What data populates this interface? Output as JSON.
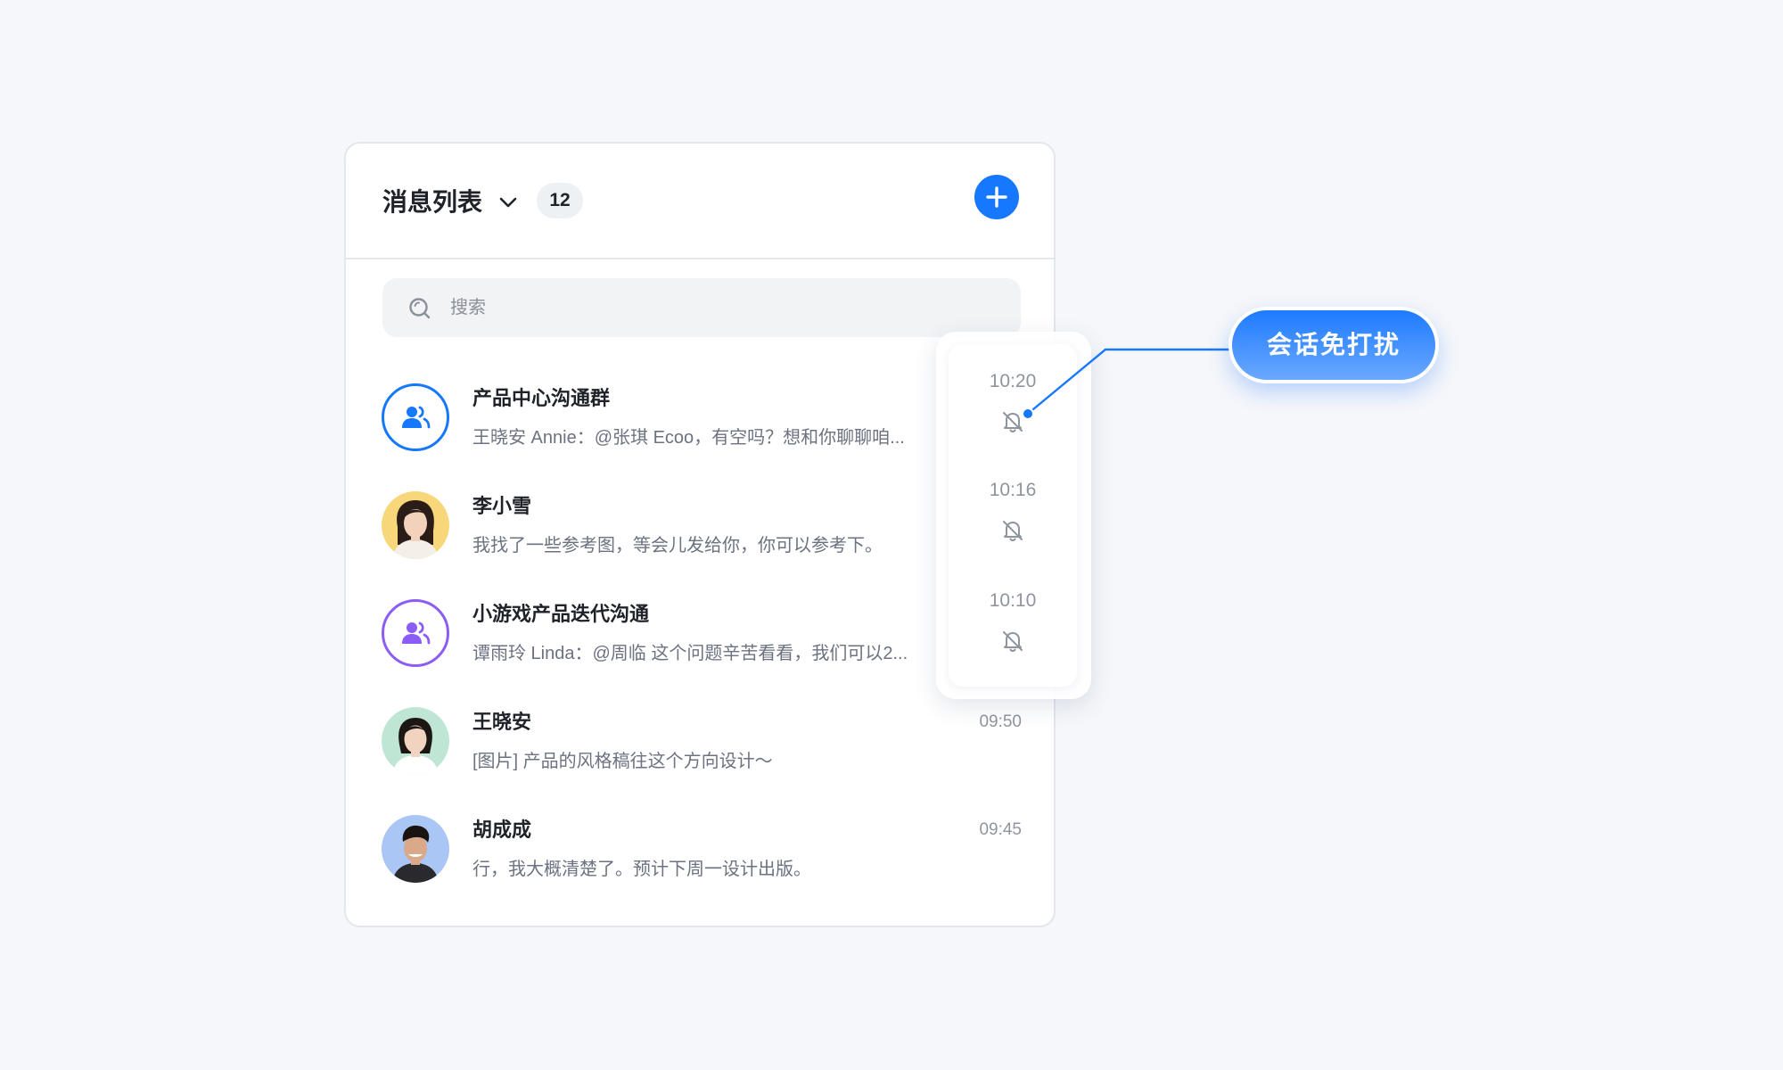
{
  "header": {
    "title": "消息列表",
    "count": "12"
  },
  "search": {
    "placeholder": "搜索"
  },
  "conversations": [
    {
      "name": "产品中心沟通群",
      "preview": "王晓安 Annie：@张琪 Ecoo，有空吗？想和你聊聊咱...",
      "time": "",
      "avatar": "group-blue",
      "muted": true
    },
    {
      "name": "李小雪",
      "preview": "我找了一些参考图，等会儿发给你，你可以参考下。",
      "time": "",
      "avatar": "photo-woman-yellow",
      "muted": true
    },
    {
      "name": "小游戏产品迭代沟通",
      "preview": "谭雨玲 Linda：@周临 这个问题辛苦看看，我们可以2...",
      "time": "",
      "avatar": "group-purple",
      "muted": true
    },
    {
      "name": "王晓安",
      "preview": "[图片] 产品的风格稿往这个方向设计～",
      "time": "09:50",
      "avatar": "photo-woman-green",
      "muted": false
    },
    {
      "name": "胡成成",
      "preview": "行，我大概清楚了。预计下周一设计出版。",
      "time": "09:45",
      "avatar": "photo-man-blue",
      "muted": false
    }
  ],
  "popup": {
    "rows": [
      {
        "time": "10:20",
        "icon": "bell-off-icon"
      },
      {
        "time": "10:16",
        "icon": "bell-off-icon"
      },
      {
        "time": "10:10",
        "icon": "bell-off-icon"
      }
    ]
  },
  "callout": {
    "label": "会话免打扰"
  },
  "colors": {
    "accent": "#1677ff",
    "purple": "#8b5cf6",
    "background": "#f5f7fa"
  }
}
